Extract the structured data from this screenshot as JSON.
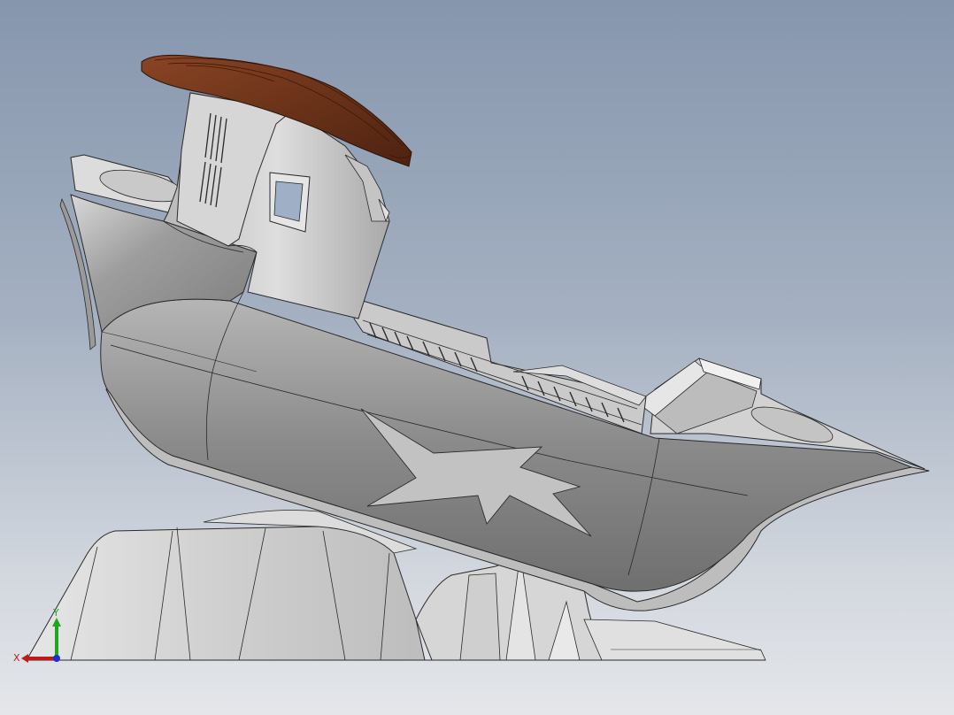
{
  "viewport": {
    "background_top": "#8696ad",
    "background_bottom": "#e4e6ea"
  },
  "model": {
    "hull_color": "#8e8e8e",
    "hull_light": "#c9c9c9",
    "deck_color": "#d6d6d6",
    "roof_color": "#6b3319",
    "base_color": "#d4d4d4",
    "edge_color": "#2a2a2a"
  },
  "triad": {
    "x_label": "X",
    "y_label": "Y",
    "x_color": "#c21a1a",
    "y_color": "#1fa51f",
    "z_color": "#1c2fd1",
    "icon": "coordinate-triad-icon"
  }
}
